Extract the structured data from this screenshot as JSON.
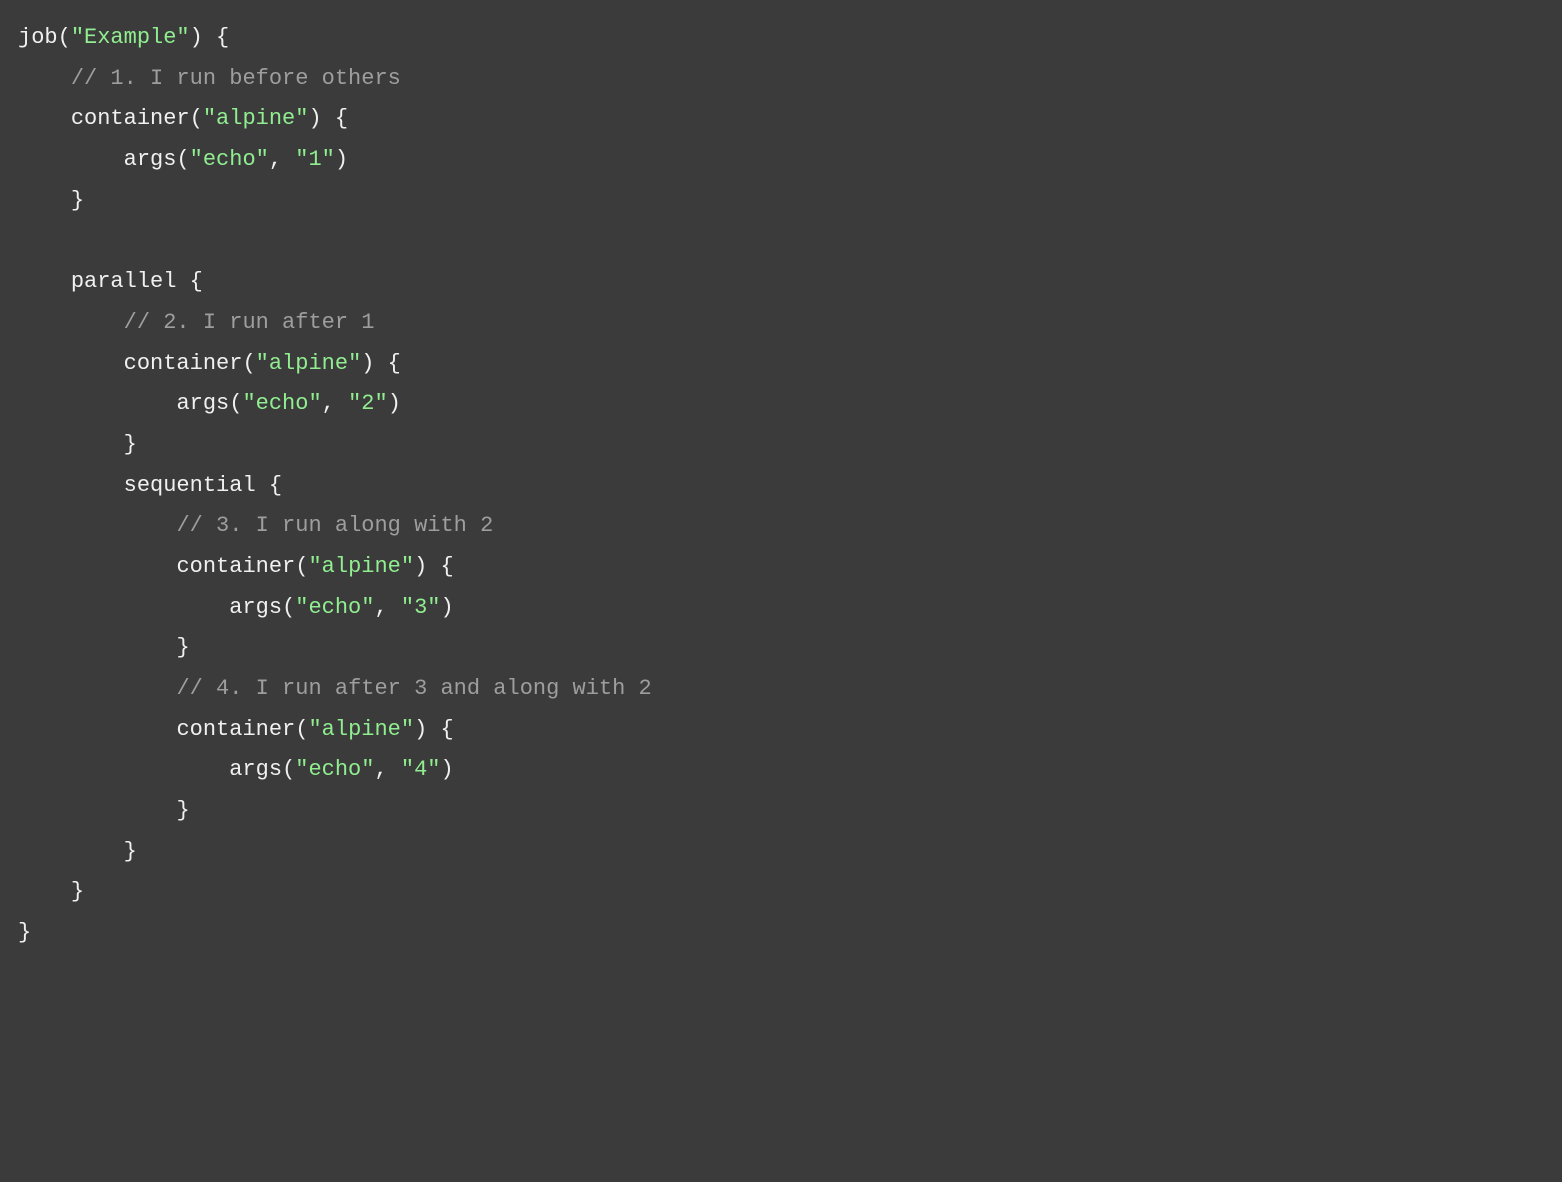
{
  "code": {
    "line1": {
      "t1": "job(",
      "s1": "\"Example\"",
      "t2": ") {"
    },
    "line2": {
      "indent": "    ",
      "c1": "// 1. I run before others"
    },
    "line3": {
      "indent": "    ",
      "t1": "container(",
      "s1": "\"alpine\"",
      "t2": ") {"
    },
    "line4": {
      "indent": "        ",
      "t1": "args(",
      "s1": "\"echo\"",
      "t2": ", ",
      "s2": "\"1\"",
      "t3": ")"
    },
    "line5": {
      "indent": "    ",
      "t1": "}"
    },
    "line6": {
      "t1": ""
    },
    "line7": {
      "indent": "    ",
      "t1": "parallel {"
    },
    "line8": {
      "indent": "        ",
      "c1": "// 2. I run after 1"
    },
    "line9": {
      "indent": "        ",
      "t1": "container(",
      "s1": "\"alpine\"",
      "t2": ") {"
    },
    "line10": {
      "indent": "            ",
      "t1": "args(",
      "s1": "\"echo\"",
      "t2": ", ",
      "s2": "\"2\"",
      "t3": ")"
    },
    "line11": {
      "indent": "        ",
      "t1": "}"
    },
    "line12": {
      "indent": "        ",
      "t1": "sequential {"
    },
    "line13": {
      "indent": "            ",
      "c1": "// 3. I run along with 2"
    },
    "line14": {
      "indent": "            ",
      "t1": "container(",
      "s1": "\"alpine\"",
      "t2": ") {"
    },
    "line15": {
      "indent": "                ",
      "t1": "args(",
      "s1": "\"echo\"",
      "t2": ", ",
      "s2": "\"3\"",
      "t3": ")"
    },
    "line16": {
      "indent": "            ",
      "t1": "}"
    },
    "line17": {
      "indent": "            ",
      "c1": "// 4. I run after 3 and along with 2"
    },
    "line18": {
      "indent": "            ",
      "t1": "container(",
      "s1": "\"alpine\"",
      "t2": ") {"
    },
    "line19": {
      "indent": "                ",
      "t1": "args(",
      "s1": "\"echo\"",
      "t2": ", ",
      "s2": "\"4\"",
      "t3": ")"
    },
    "line20": {
      "indent": "            ",
      "t1": "}"
    },
    "line21": {
      "indent": "        ",
      "t1": "}"
    },
    "line22": {
      "indent": "    ",
      "t1": "}"
    },
    "line23": {
      "t1": "}"
    }
  }
}
